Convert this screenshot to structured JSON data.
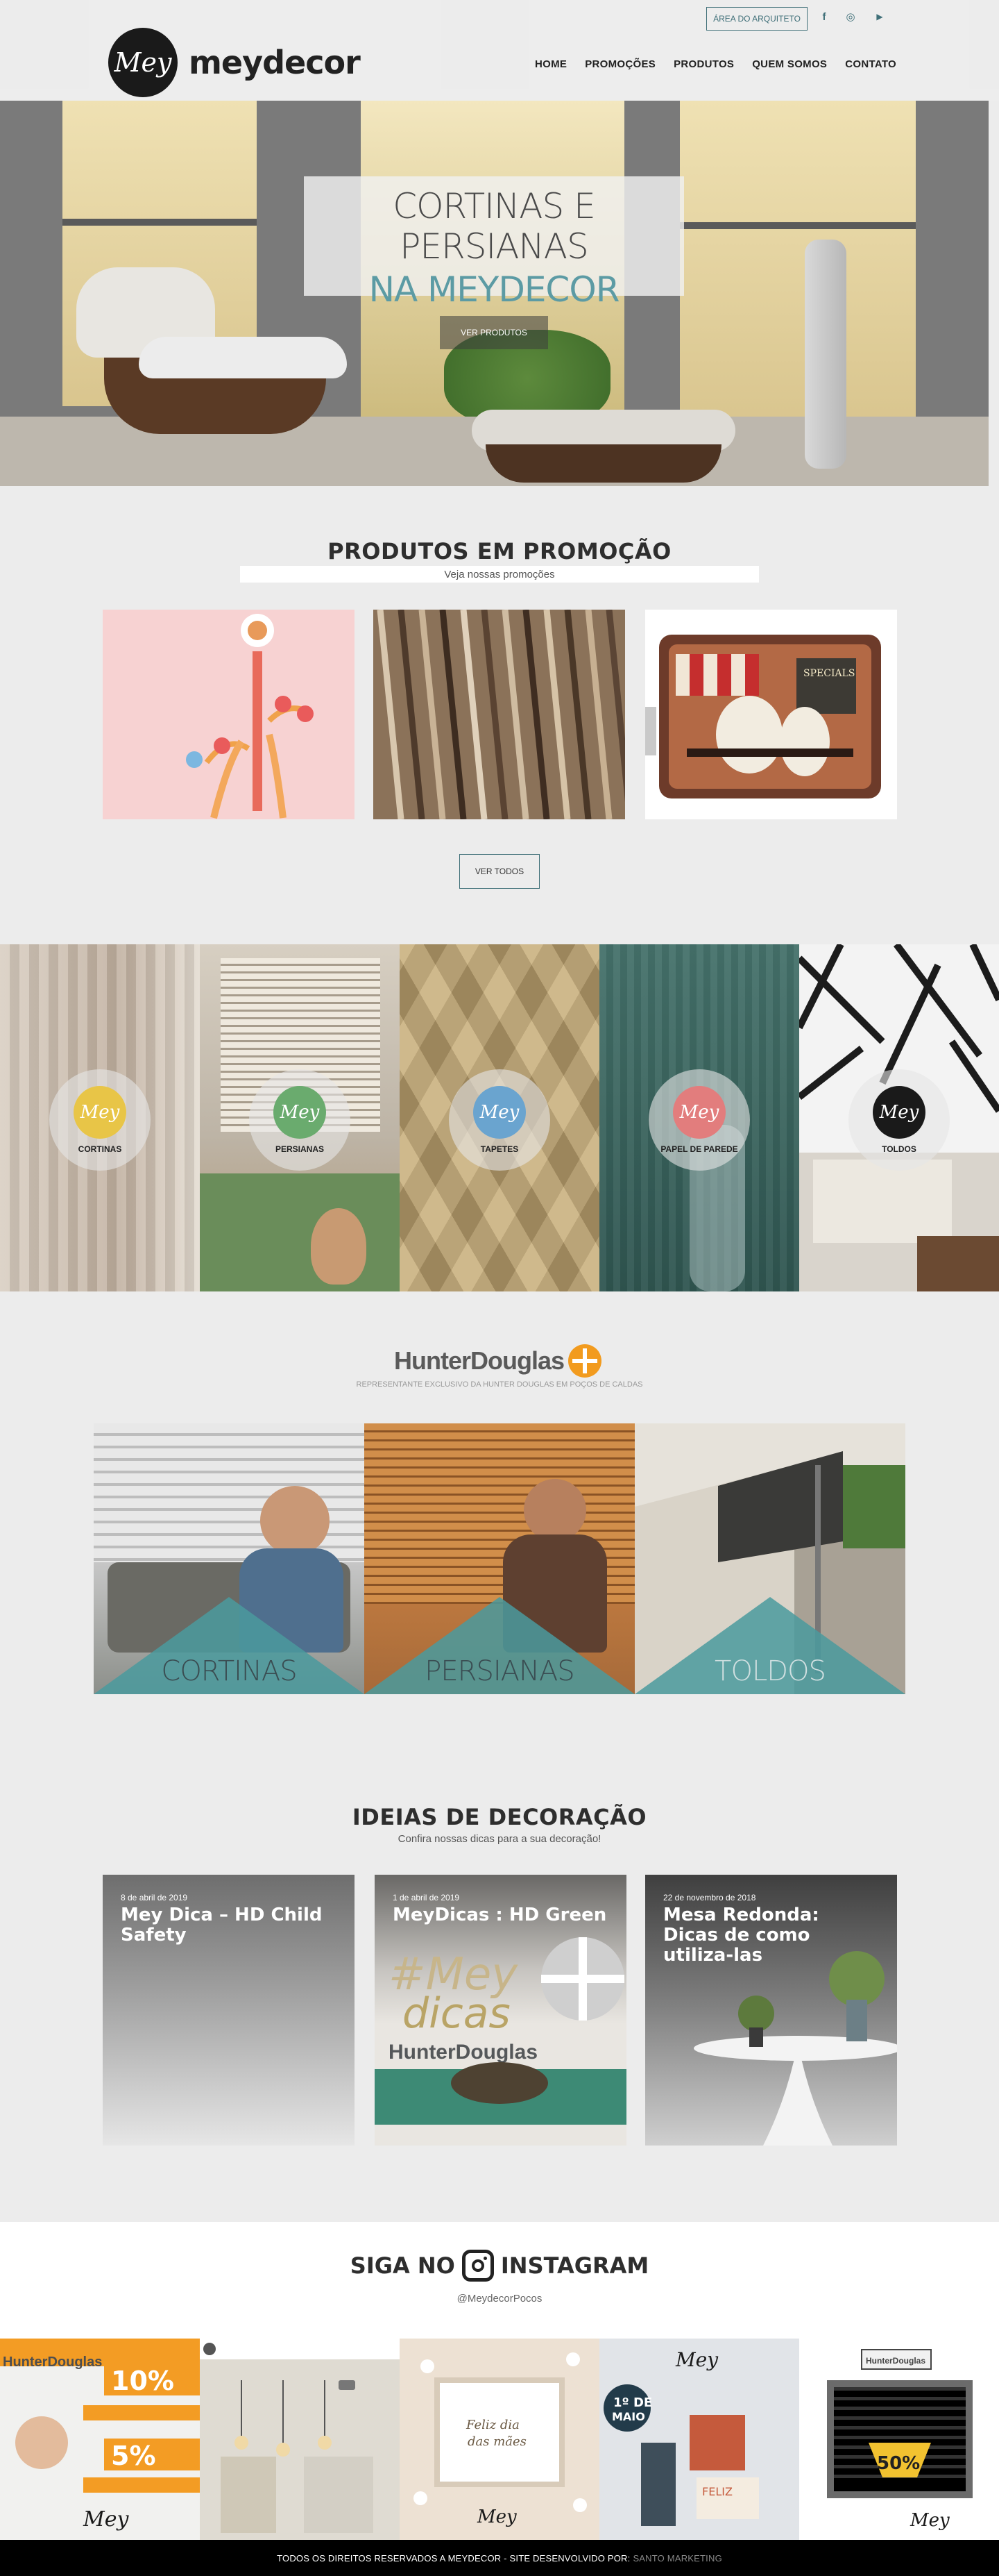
{
  "header": {
    "logo_mark": "Mey",
    "logo_text": "meydecor",
    "architect_button": "ÁREA DO ARQUITETO",
    "social": [
      "f",
      "◎",
      "▶"
    ],
    "nav": [
      "HOME",
      "PROMOÇÕES",
      "PRODUTOS",
      "QUEM SOMOS",
      "CONTATO"
    ]
  },
  "hero": {
    "line1": "CORTINAS E PERSIANAS",
    "line2": "NA MEYDECOR",
    "button": "VER PRODUTOS"
  },
  "promo": {
    "title": "PRODUTOS EM PROMOÇÃO",
    "subtitle": "Veja nossas promoções",
    "button": "VER TODOS"
  },
  "categories": [
    {
      "label": "CORTINAS",
      "color": "#e8c547"
    },
    {
      "label": "PERSIANAS",
      "color": "#6aab6e"
    },
    {
      "label": "TAPETES",
      "color": "#6aa4cf"
    },
    {
      "label": "PAPEL DE PAREDE",
      "color": "#e27d7d"
    },
    {
      "label": "TOLDOS",
      "color": "#1a1a1a"
    }
  ],
  "category_logo": "Mey",
  "hunter": {
    "logo": "HunterDouglas",
    "subtitle": "REPRESENTANTE EXCLUSIVO DA HUNTER DOUGLAS EM POÇOS DE CALDAS",
    "panels": [
      "CORTINAS",
      "PERSIANAS",
      "TOLDOS"
    ]
  },
  "ideas": {
    "title": "IDEIAS DE DECORAÇÃO",
    "subtitle": "Confira nossas dicas para a sua decoração!",
    "posts": [
      {
        "date": "8 de abril de 2019",
        "title": "Mey Dica – HD Child Safety"
      },
      {
        "date": "1 de abril de 2019",
        "title": "MeyDicas : HD Green"
      },
      {
        "date": "22 de novembro de 2018",
        "title": "Mesa Redonda: Dicas de como utiliza-las"
      }
    ]
  },
  "instagram": {
    "title_left": "SIGA NO",
    "title_right": "INSTAGRAM",
    "handle": "@MeydecorPocos"
  },
  "footer": {
    "text": "TODOS OS DIREITOS RESERVADOS A MEYDECOR - SITE DESENVOLVIDO POR:",
    "developer": "SANTO MARKETING"
  }
}
